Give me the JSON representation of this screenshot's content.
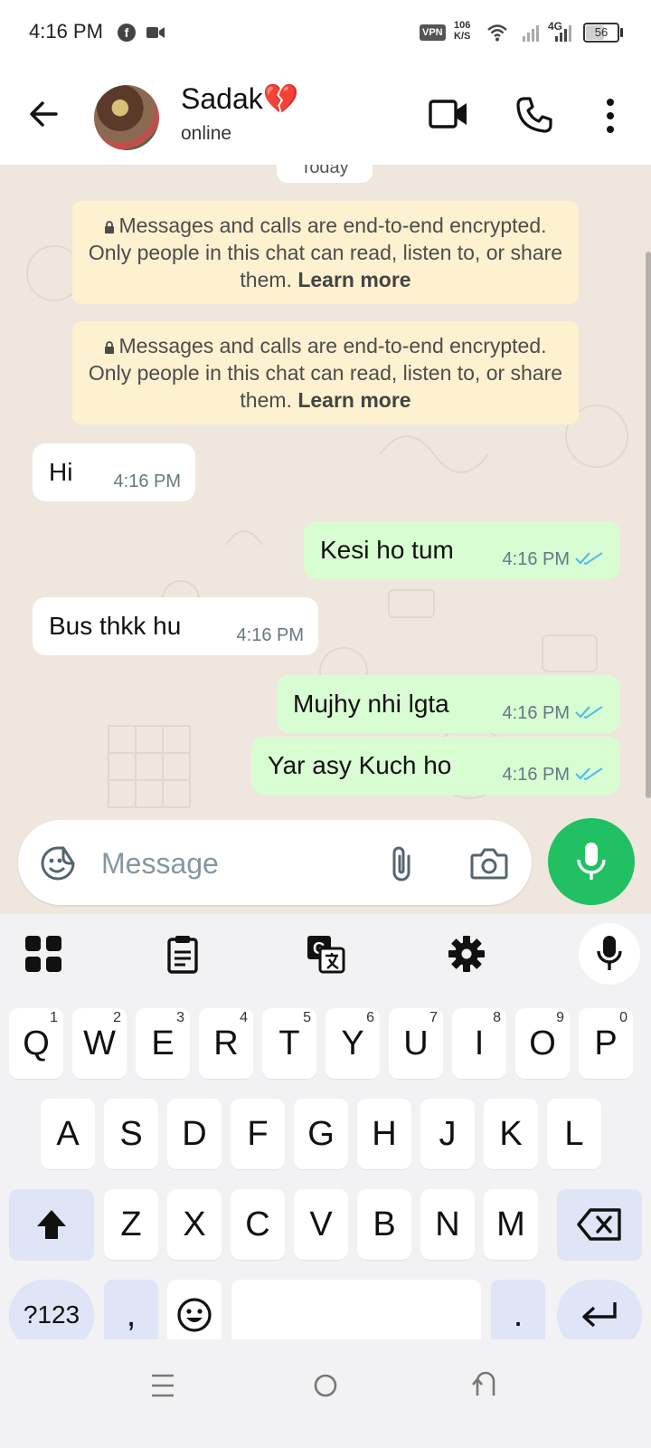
{
  "status_bar": {
    "time": "4:16 PM",
    "vpn_label": "VPN",
    "speed_value": "106",
    "speed_unit": "K/S",
    "network_type": "4G",
    "battery_level": "56",
    "battery_fraction": 0.56,
    "icons": [
      "facebook-icon",
      "video-recorder-icon",
      "wifi-icon",
      "signal-icon"
    ]
  },
  "header": {
    "contact_name": "Sadak💔",
    "status": "online",
    "icons": [
      "back-arrow-icon",
      "avatar",
      "video-call-icon",
      "phone-icon",
      "more-vertical-icon"
    ]
  },
  "chat": {
    "date_chip": "Today",
    "encryption_notices": [
      {
        "text": "Messages and calls are end-to-end encrypted. Only people in this chat can read, listen to, or share them. ",
        "link": "Learn more"
      },
      {
        "text": "Messages and calls are end-to-end encrypted. Only people in this chat can read, listen to, or share them. ",
        "link": "Learn more"
      }
    ],
    "messages": [
      {
        "direction": "incoming",
        "text": "Hi",
        "time": "4:16 PM"
      },
      {
        "direction": "outgoing",
        "text": "Kesi ho tum",
        "time": "4:16 PM",
        "read": true
      },
      {
        "direction": "incoming",
        "text": "Bus thkk hu",
        "time": "4:16 PM"
      },
      {
        "direction": "outgoing",
        "text": "Mujhy nhi lgta",
        "time": "4:16 PM",
        "read": true
      },
      {
        "direction": "outgoing",
        "text": "Yar asy Kuch ho",
        "time": "4:16 PM",
        "read": true
      }
    ],
    "read_tick_color": "#53bdeb"
  },
  "composer": {
    "placeholder": "Message",
    "value": "",
    "accent_color": "#21c063",
    "icons": [
      "sticker-icon",
      "paperclip-icon",
      "camera-icon",
      "microphone-icon"
    ]
  },
  "keyboard": {
    "toolbar_icons": [
      "apps-grid-icon",
      "clipboard-icon",
      "translate-icon",
      "settings-gear-icon",
      "microphone-icon"
    ],
    "row1": [
      {
        "key": "Q",
        "hint": "1"
      },
      {
        "key": "W",
        "hint": "2"
      },
      {
        "key": "E",
        "hint": "3"
      },
      {
        "key": "R",
        "hint": "4"
      },
      {
        "key": "T",
        "hint": "5"
      },
      {
        "key": "Y",
        "hint": "6"
      },
      {
        "key": "U",
        "hint": "7"
      },
      {
        "key": "I",
        "hint": "8"
      },
      {
        "key": "O",
        "hint": "9"
      },
      {
        "key": "P",
        "hint": "0"
      }
    ],
    "row2": [
      "A",
      "S",
      "D",
      "F",
      "G",
      "H",
      "J",
      "K",
      "L"
    ],
    "row3": [
      "Z",
      "X",
      "C",
      "V",
      "B",
      "N",
      "M"
    ],
    "bottom": {
      "symbols": "?123",
      "comma": ",",
      "period": "."
    },
    "special_key_color": "#dfe4f6"
  },
  "nav_bar": {
    "icons": [
      "recents-icon",
      "home-icon",
      "back-icon"
    ]
  }
}
